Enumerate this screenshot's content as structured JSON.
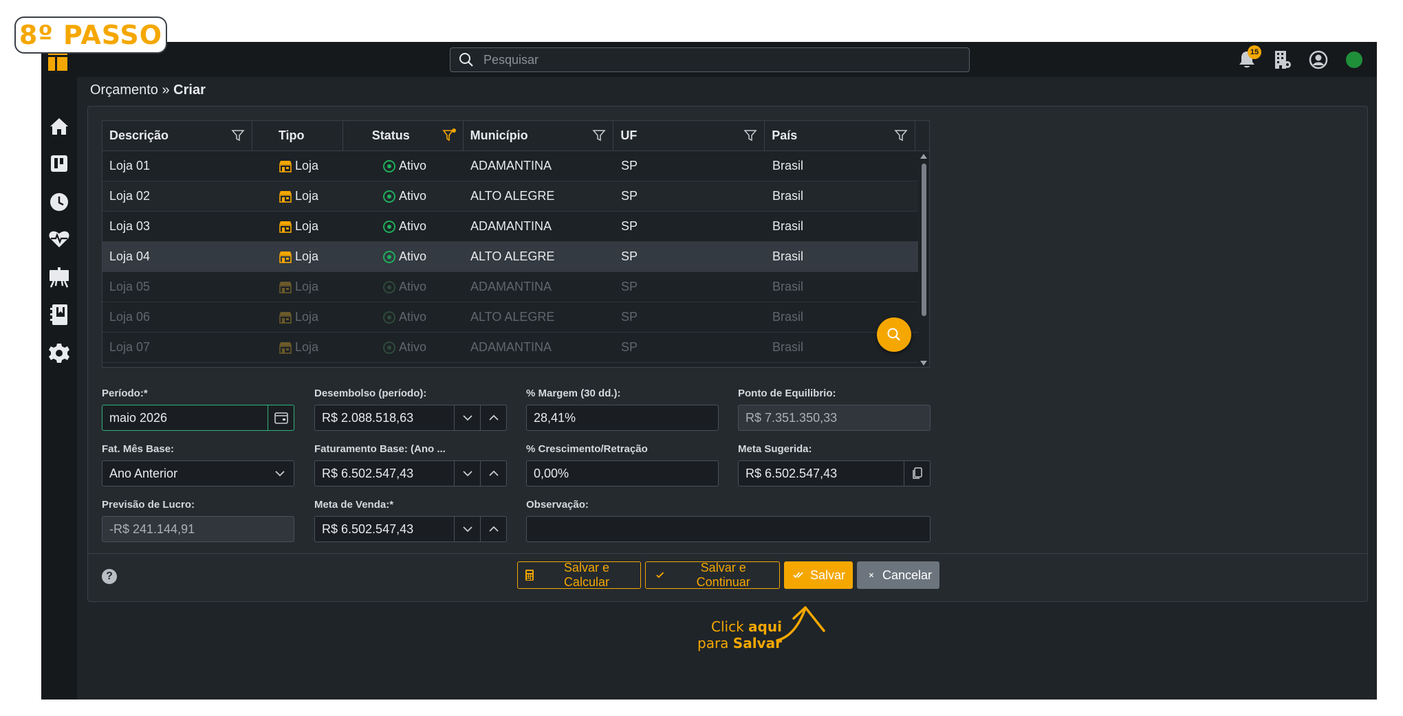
{
  "step_badge": "8º PASSO",
  "search": {
    "placeholder": "Pesquisar"
  },
  "notifications": {
    "count": "15"
  },
  "breadcrumb": {
    "parent": "Orçamento » ",
    "current": "Criar"
  },
  "table": {
    "columns": [
      "Descrição",
      "Tipo",
      "Status",
      "Município",
      "UF",
      "País"
    ],
    "rows": [
      {
        "descricao": "Loja 01",
        "tipo": "Loja",
        "status": "Ativo",
        "municipio": "ADAMANTINA",
        "uf": "SP",
        "pais": "Brasil"
      },
      {
        "descricao": "Loja 02",
        "tipo": "Loja",
        "status": "Ativo",
        "municipio": "ALTO ALEGRE",
        "uf": "SP",
        "pais": "Brasil"
      },
      {
        "descricao": "Loja 03",
        "tipo": "Loja",
        "status": "Ativo",
        "municipio": "ADAMANTINA",
        "uf": "SP",
        "pais": "Brasil"
      },
      {
        "descricao": "Loja 04",
        "tipo": "Loja",
        "status": "Ativo",
        "municipio": "ALTO ALEGRE",
        "uf": "SP",
        "pais": "Brasil"
      },
      {
        "descricao": "Loja 05",
        "tipo": "Loja",
        "status": "Ativo",
        "municipio": "ADAMANTINA",
        "uf": "SP",
        "pais": "Brasil"
      },
      {
        "descricao": "Loja 06",
        "tipo": "Loja",
        "status": "Ativo",
        "municipio": "ALTO ALEGRE",
        "uf": "SP",
        "pais": "Brasil"
      },
      {
        "descricao": "Loja 07",
        "tipo": "Loja",
        "status": "Ativo",
        "municipio": "ADAMANTINA",
        "uf": "SP",
        "pais": "Brasil"
      }
    ]
  },
  "form": {
    "periodo": {
      "label": "Período:*",
      "value": "maio 2026"
    },
    "desembolso": {
      "label": "Desembolso (período):",
      "value": "R$ 2.088.518,63"
    },
    "margem": {
      "label": "% Margem (30 dd.):",
      "value": "28,41%"
    },
    "ponto_equilibrio": {
      "label": "Ponto de Equilibrio:",
      "value": "R$ 7.351.350,33"
    },
    "fat_mes_base": {
      "label": "Fat. Mês Base:",
      "value": "Ano Anterior"
    },
    "faturamento_base": {
      "label": "Faturamento Base: (Ano ...",
      "value": "R$ 6.502.547,43"
    },
    "crescimento": {
      "label": "% Crescimento/Retração",
      "value": "0,00%"
    },
    "meta_sugerida": {
      "label": "Meta Sugerida:",
      "value": "R$ 6.502.547,43"
    },
    "previsao_lucro": {
      "label": "Previsão de Lucro:",
      "value": "-R$ 241.144,91"
    },
    "meta_venda": {
      "label": "Meta de Venda:*",
      "value": "R$ 6.502.547,43"
    },
    "observacao": {
      "label": "Observação:",
      "value": ""
    }
  },
  "footer": {
    "help": "?",
    "salvar_calcular": "Salvar e Calcular",
    "salvar_continuar": "Salvar e Continuar",
    "salvar": "Salvar",
    "cancelar": "Cancelar"
  },
  "annotation": {
    "line1_a": "Click ",
    "line1_b": "aqui",
    "line2_a": "para ",
    "line2_b": "Salvar"
  },
  "colors": {
    "accent": "#f5a700",
    "background": "#1f2428",
    "active_status": "#1fae5b"
  }
}
